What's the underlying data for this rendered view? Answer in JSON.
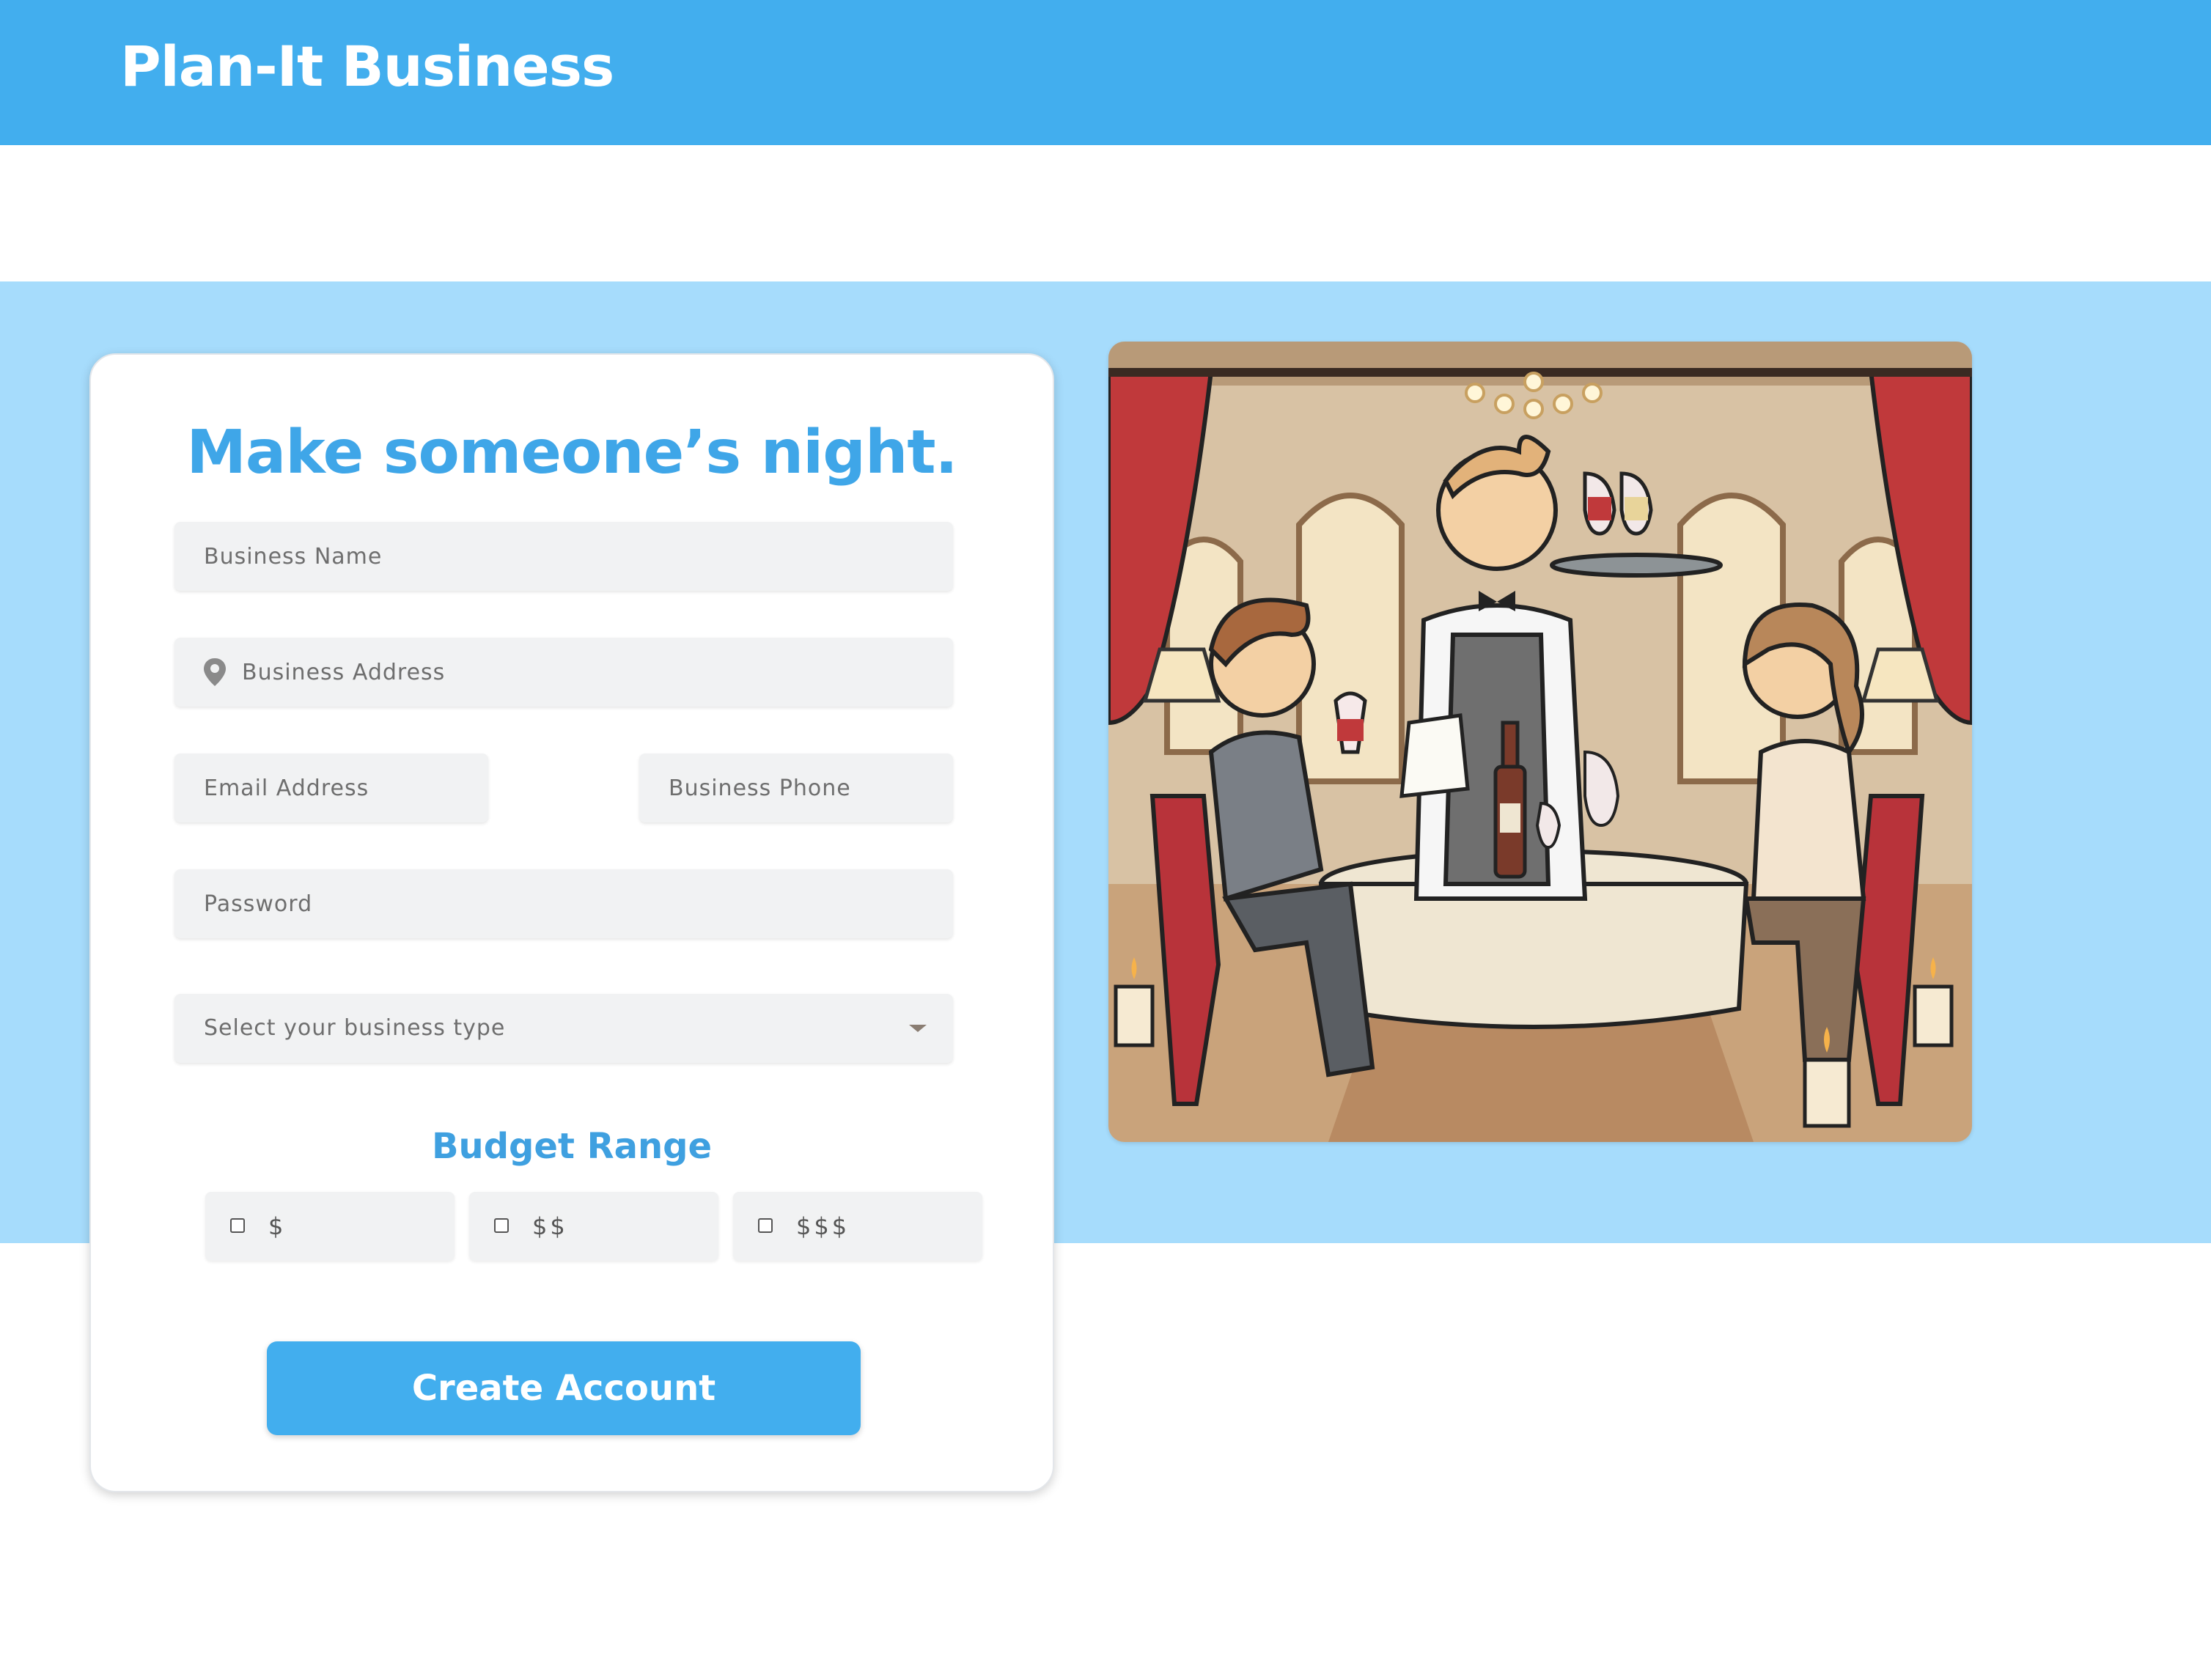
{
  "header": {
    "brand": "Plan-It Business"
  },
  "form": {
    "headline": "Make someone’s night.",
    "business_name_placeholder": "Business Name",
    "business_address_placeholder": "Business Address",
    "email_placeholder": "Email Address",
    "phone_placeholder": "Business Phone",
    "password_placeholder": "Password",
    "business_type": {
      "selected": "Select your business type"
    },
    "budget": {
      "title": "Budget Range",
      "options": [
        "$",
        "$$",
        "$$$"
      ],
      "checked": [
        false,
        false,
        false
      ]
    },
    "submit_label": "Create Account"
  },
  "illustration": {
    "subject": "restaurant-dining-illustration",
    "colors": {
      "wall": "#d8c2a4",
      "curtain": "#c0393b",
      "cloth": "#efe6d2"
    }
  },
  "colors": {
    "brand": "#42aeee",
    "band": "#a6dcfc",
    "heading": "#3fa6e8"
  }
}
